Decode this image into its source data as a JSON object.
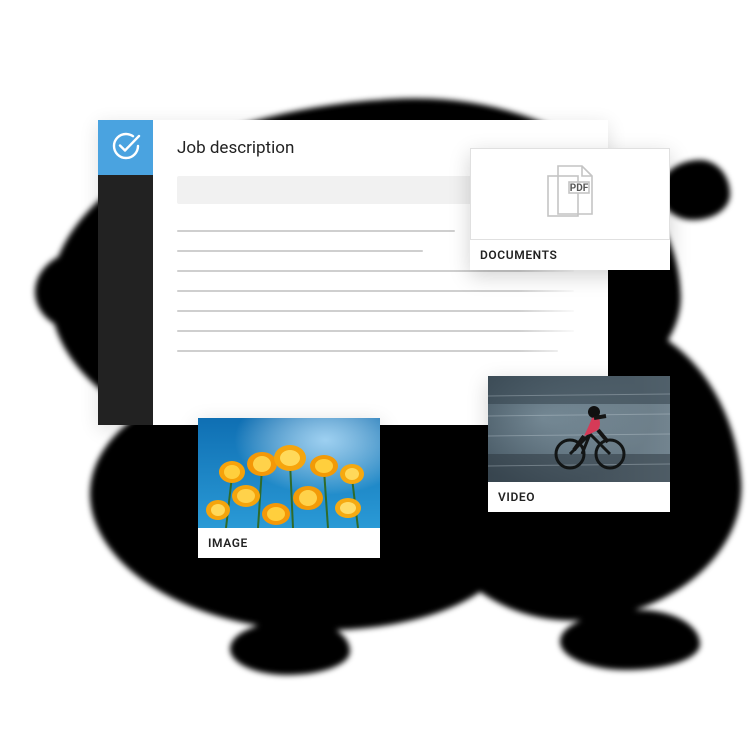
{
  "window": {
    "title": "Job description"
  },
  "tiles": {
    "documents": {
      "label": "DOCUMENTS",
      "file_type": "PDF"
    },
    "video": {
      "label": "VIDEO"
    },
    "image": {
      "label": "IMAGE"
    }
  },
  "colors": {
    "accent": "#4aa3e0"
  }
}
